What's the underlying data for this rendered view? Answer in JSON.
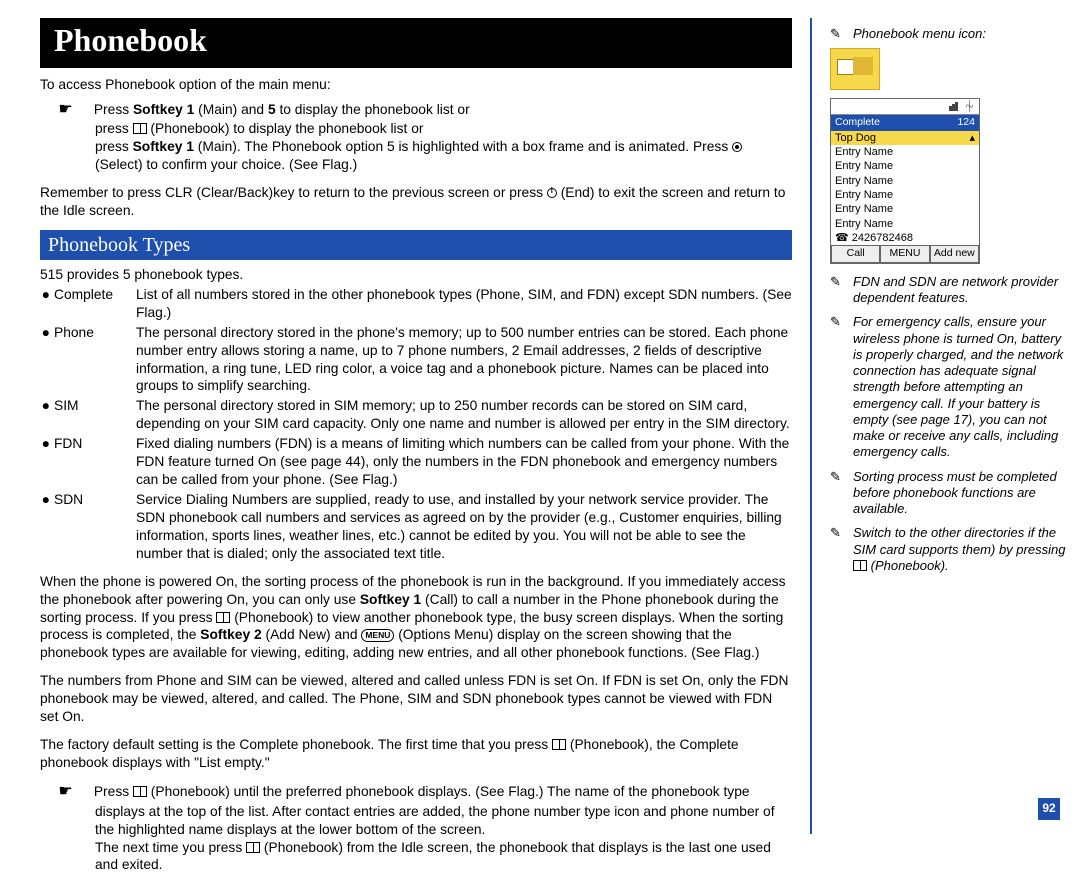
{
  "title": "Phonebook",
  "intro": "To access Phonebook option of the main menu:",
  "step1_a": "Press ",
  "step1_b": "Softkey 1",
  "step1_c": " (Main) and ",
  "step1_d": "5",
  "step1_e": " to display the phonebook list or",
  "step1_line2": "press ",
  "step1_line2b": " (Phonebook) to display the phonebook list or",
  "step1_line3a": "press ",
  "step1_line3b": "Softkey 1",
  "step1_line3c": " (Main). The Phonebook option 5 is highlighted with a box frame and is animated. Press ",
  "step1_line3d": " (Select) to confirm your choice. (See Flag.)",
  "remember_a": "Remember to press CLR  (Clear/Back)key to return to the previous screen or press ",
  "remember_b": " (End) to exit the screen and return to the Idle screen.",
  "section": "Phonebook Types",
  "types_intro": "515 provides 5 phonebook types.",
  "types": [
    {
      "name": "Complete",
      "desc": "List of all numbers stored in the other phonebook types (Phone, SIM, and FDN) except SDN numbers. (See Flag.)"
    },
    {
      "name": "Phone",
      "desc": "The personal directory stored in the phone's memory; up to 500 number entries can be stored. Each phone number entry allows storing a name, up to 7 phone numbers, 2 Email addresses, 2 fields of descriptive information, a ring tune, LED ring color, a voice tag and a phonebook picture. Names can be placed into groups to simplify searching."
    },
    {
      "name": "SIM",
      "desc": "The personal directory stored in SIM memory; up to 250 number records can be stored on SIM card, depending on your SIM card capacity. Only one name and number is allowed per entry in the SIM directory."
    },
    {
      "name": "FDN",
      "desc": "Fixed dialing numbers (FDN) is a means of limiting which numbers can be called from your phone. With the FDN feature turned On (see page 44), only the numbers in the FDN phonebook and emergency numbers can be called from your phone. (See Flag.)"
    },
    {
      "name": "SDN",
      "desc": "Service Dialing Numbers are supplied, ready to use, and installed by your network service provider. The SDN phonebook call numbers and services as agreed on by the provider (e.g., Customer enquiries, billing information, sports lines, weather lines, etc.) cannot be edited by you. You will not be able to see the number that is dialed; only the associated text title."
    }
  ],
  "p1_a": "When the phone is powered On, the sorting process of the phonebook is run in the background. If you immediately access the phonebook after powering On, you can only use ",
  "p1_b": "Softkey 1",
  "p1_c": " (Call) to call a number in the Phone phonebook during the sorting process. If you press ",
  "p1_d": " (Phonebook) to view another phonebook type, the busy screen displays. When the sorting process is completed, the ",
  "p1_e": "Softkey 2",
  "p1_f": " (Add New) and ",
  "p1_g": " (Options Menu) display on the screen showing that the phonebook types are available for viewing, editing, adding new entries, and all other phonebook functions. (See Flag.)",
  "p2": "The numbers from Phone and SIM can be viewed, altered and called unless FDN is set On. If FDN is set On, only the FDN phonebook may be viewed, altered, and called. The Phone, SIM and SDN phonebook types cannot be viewed with FDN set On.",
  "p3_a": "The factory default setting is the Complete phonebook. The first time that you press ",
  "p3_b": " (Phonebook), the Complete phonebook displays with \"List empty.\"",
  "step2_a": "Press ",
  "step2_b": " (Phonebook) until the preferred phonebook displays. (See Flag.) The name of the phonebook type displays at the top of the list. After contact entries are added, the phone number type icon and phone number of the highlighted name displays at the lower bottom of the screen.",
  "step2_line2_a": "The next time you press ",
  "step2_line2_b": " (Phonebook) from the Idle screen, the phonebook that displays is the last one used and exited.",
  "side": {
    "n1": "Phonebook menu icon:",
    "n2": "FDN and SDN are network provider dependent features.",
    "n3": "For emergency calls, ensure your wireless phone is turned On, battery is properly charged, and the network connection has adequate signal strength before attempting an emergency call. If your battery is empty (see page 17), you can not make or receive any calls, including emergency calls.",
    "n4": "Sorting process must be completed before phonebook functions are available.",
    "n5_a": "Switch to the other directories if the SIM card supports them) by pressing ",
    "n5_b": " (Phonebook)."
  },
  "phone": {
    "title": "Complete",
    "count": "124",
    "selected": "Top Dog",
    "items": [
      "Entry Name",
      "Entry Name",
      "Entry Name",
      "Entry Name",
      "Entry Name",
      "Entry Name"
    ],
    "number": "2426782468",
    "b1": "Call",
    "b2": "MENU",
    "b3": "Add new"
  },
  "menu_pill": "MENU",
  "pagenum": "92"
}
